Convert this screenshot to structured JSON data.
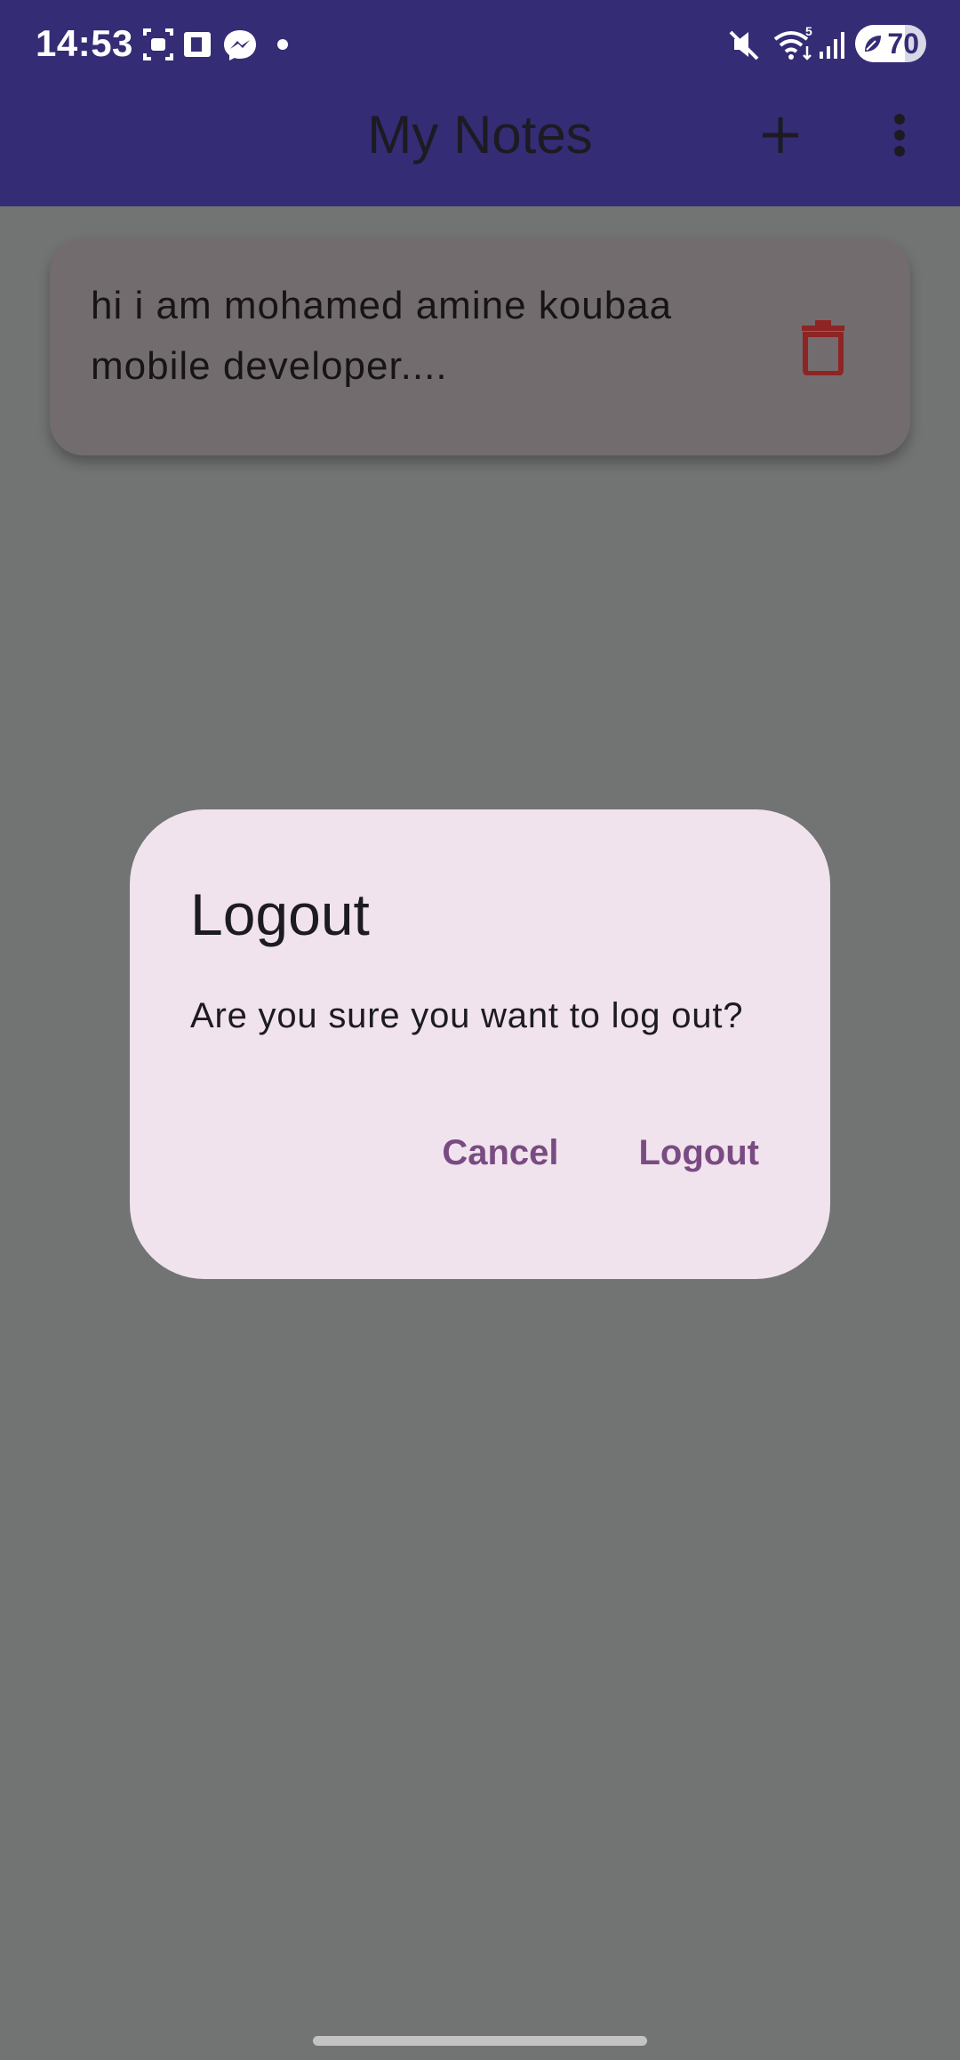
{
  "status_bar": {
    "time": "14:53",
    "icons": [
      "screenshot-icon",
      "sim-card-icon",
      "messenger-icon",
      "notification-dot-icon",
      "mute-icon",
      "wifi-icon",
      "signal-icon"
    ],
    "battery_level": "70",
    "battery_percent": 70
  },
  "app_bar": {
    "title": "My Notes",
    "actions": [
      "add-icon",
      "more-vert-icon"
    ]
  },
  "notes": [
    {
      "text": "hi i am mohamed amine koubaa mobile developer....",
      "action_icon": "delete-icon"
    }
  ],
  "dialog": {
    "title": "Logout",
    "message": "Are you sure you want to log out?",
    "cancel_label": "Cancel",
    "confirm_label": "Logout"
  },
  "colors": {
    "app_bar": "#342c75",
    "scrim_background": "#727473",
    "note_card": "#736c6e",
    "dialog_background": "#f0e3ed",
    "dialog_button_text": "#7a4b82",
    "delete_icon": "#8e2424"
  }
}
